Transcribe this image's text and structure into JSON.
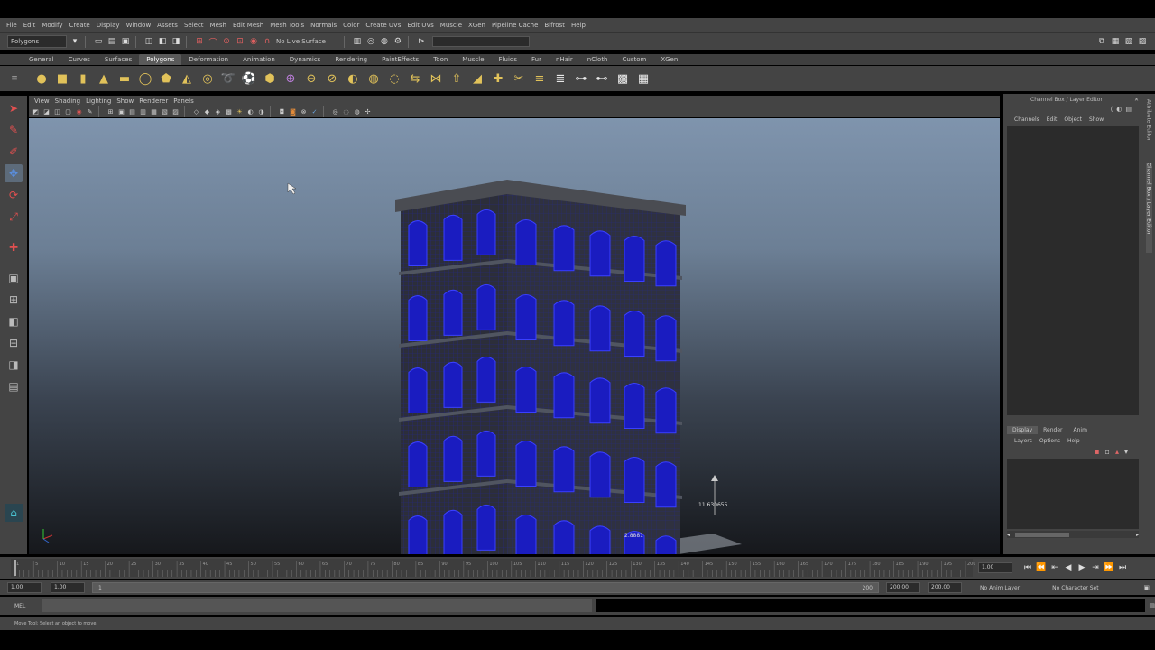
{
  "menus": [
    "File",
    "Edit",
    "Modify",
    "Create",
    "Display",
    "Window",
    "Assets",
    "Select",
    "Mesh",
    "Edit Mesh",
    "Mesh Tools",
    "Normals",
    "Color",
    "Create UVs",
    "Edit UVs",
    "Muscle",
    "XGen",
    "Pipeline Cache",
    "Bifrost",
    "Help"
  ],
  "statusline": {
    "menuset": "Polygons",
    "live_surface": "No Live Surface"
  },
  "shelf": {
    "tabs": [
      "General",
      "Curves",
      "Surfaces",
      "Polygons",
      "Deformation",
      "Animation",
      "Dynamics",
      "Rendering",
      "PaintEffects",
      "Toon",
      "Muscle",
      "Fluids",
      "Fur",
      "nHair",
      "nCloth",
      "Custom",
      "XGen"
    ],
    "active_tab": "Polygons",
    "icons": [
      "sphere-icon",
      "cube-icon",
      "cylinder-icon",
      "cone-icon",
      "plane-icon",
      "torus-icon",
      "prism-icon",
      "pyramid-icon",
      "pipe-icon",
      "helix-icon",
      "soccer-icon",
      "platonic-icon",
      "combine-icon",
      "separate-icon",
      "extract-icon",
      "booleans-icon",
      "smooth-icon",
      "average-icon",
      "mirror-icon",
      "bridge-icon",
      "extrude-icon",
      "bevel-icon",
      "append-icon",
      "split-icon",
      "insert-loop-icon",
      "offset-loop-icon",
      "merge-icon",
      "weld-icon",
      "checker-icon",
      "uv-icon"
    ]
  },
  "panel": {
    "menus": [
      "View",
      "Shading",
      "Lighting",
      "Show",
      "Renderer",
      "Panels"
    ],
    "annotation": "11.630655",
    "annotation2": "2.8881"
  },
  "channelbox": {
    "title": "Channel Box / Layer Editor",
    "menus": [
      "Channels",
      "Edit",
      "Object",
      "Show"
    ],
    "layer_tabs": [
      "Display",
      "Render",
      "Anim"
    ],
    "layer_menus": [
      "Layers",
      "Options",
      "Help"
    ]
  },
  "sidetabs": [
    "Attribute Editor",
    "Channel Box / Layer Editor"
  ],
  "timeline": {
    "ticks": [
      1,
      5,
      10,
      15,
      20,
      25,
      30,
      35,
      40,
      45,
      50,
      55,
      60,
      65,
      70,
      75,
      80,
      85,
      90,
      95,
      100,
      105,
      110,
      115,
      120,
      125,
      130,
      135,
      140,
      145,
      150,
      155,
      160,
      165,
      170,
      175,
      180,
      185,
      190,
      195,
      200
    ],
    "current": "1.00"
  },
  "range": {
    "start": "1.00",
    "start_inner": "1.00",
    "slider_start": "1",
    "slider_end": "200",
    "end_inner": "200.00",
    "end": "200.00",
    "anim_layer": "No Anim Layer",
    "char_set": "No Character Set"
  },
  "cmdline": {
    "label": "MEL"
  },
  "helpline": {
    "text": "Move Tool: Select an object to move."
  },
  "colors": {
    "viewport_top": "#7f94ad",
    "viewport_bottom": "#16181c",
    "ui_bg": "#444444",
    "wireframe": "#1e22c8"
  }
}
